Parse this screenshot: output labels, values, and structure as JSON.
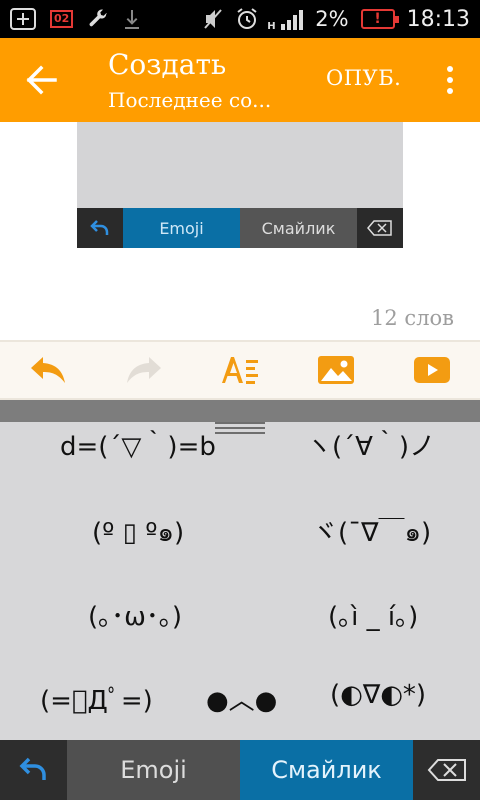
{
  "status_bar": {
    "sim_label": "02",
    "battery_percent": "2%",
    "battery_alert": "!",
    "signal_label": "H",
    "signal_sub": "1",
    "time": "18:13",
    "icons": [
      "plus-box-icon",
      "sim-icon",
      "wrench-icon",
      "download-icon",
      "mute-icon",
      "alarm-icon",
      "signal-icon",
      "battery-icon"
    ]
  },
  "action_bar": {
    "title": "Создать",
    "subtitle": "Последнее со...",
    "publish_label": "ОПУБ.",
    "accent_color": "#ff9d00"
  },
  "preview": {
    "emoji_tab": "Emoji",
    "smile_tab": "Смайлик"
  },
  "editor": {
    "word_count": "12 слов"
  },
  "format_bar": {
    "accent_color": "#f39c12",
    "disabled_color": "#e2ddd6"
  },
  "emoticons": [
    "d=(´▽｀)=b",
    "ヽ(´∀｀)ノ",
    "(º ▯ º๑)",
    "ヾ(¯∇￣๑)",
    "(｡･ω･｡)",
    "(｡ì _ í｡)",
    "(=ﾟДﾟ=)",
    "●︿●",
    "(◐∇◐*)"
  ],
  "keyboard_tabs": {
    "emoji_label": "Emoji",
    "smile_label": "Смайлик",
    "active_color": "#0a6fa5"
  }
}
